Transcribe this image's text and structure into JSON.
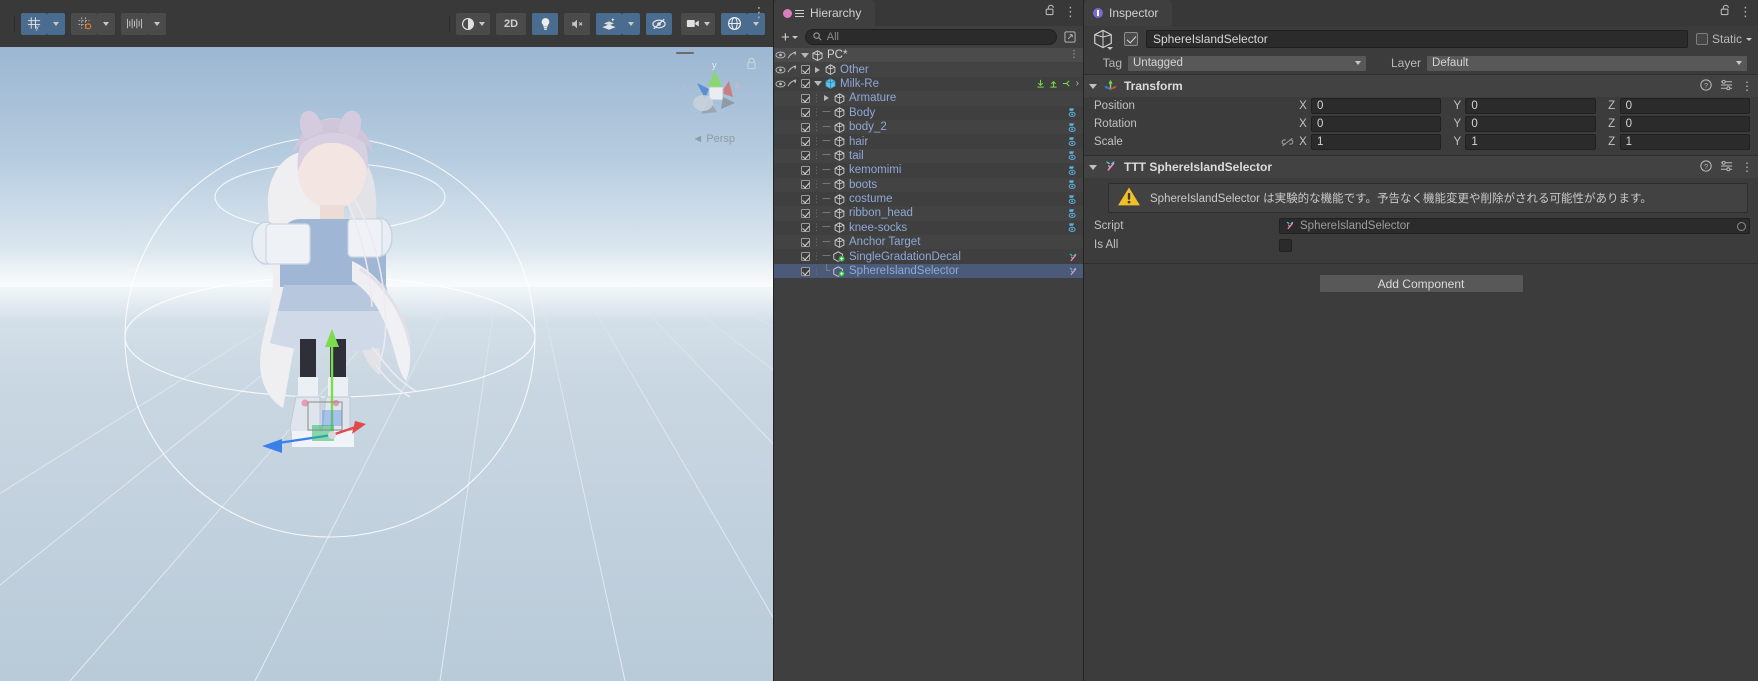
{
  "scene": {
    "toolbar": {
      "grid_visibility_icon": "grid-icon",
      "grid_visibility_dropdown": "chevron-down-icon",
      "grid_snapping_icon": "grid-snap-icon",
      "grid_snapping_dropdown": "chevron-down-icon",
      "snap_increment_icon": "snap-increment-icon",
      "snap_increment_dropdown": "chevron-down-icon",
      "draw_mode_icon": "shading-mode-icon",
      "draw_mode_dropdown": "chevron-down-icon",
      "twod_label": "2D",
      "lighting_icon": "lightbulb-icon",
      "audio_icon": "audio-mute-icon",
      "fx_icon": "effects-icon",
      "fx_dropdown": "chevron-down-icon",
      "hidden_objects_icon": "visibility-off-icon",
      "camera_icon": "scene-camera-icon",
      "camera_dropdown": "chevron-down-icon",
      "gizmos_icon": "gizmos-icon",
      "gizmos_dropdown": "chevron-down-icon",
      "overflow_menu_icon": "kebab-menu-icon"
    },
    "gizmo": {
      "axis_x": "x",
      "axis_y": "y",
      "axis_z": "z",
      "projection_label": "Persp",
      "lock_icon": "lock-icon"
    }
  },
  "hierarchy": {
    "tab_label": "Hierarchy",
    "tab_icon": "hierarchy-icon",
    "lock_icon": "lock-open-icon",
    "menu_icon": "kebab-menu-icon",
    "add_label": "+",
    "add_dropdown_icon": "chevron-down-icon",
    "search_icon": "search-icon",
    "search_placeholder": "All",
    "search_value": "",
    "sort_icon": "sort-icon",
    "scene_name": "PC*",
    "scene_icon": "unity-scene-icon",
    "scene_menu_icon": "kebab-menu-icon",
    "items": [
      {
        "name": "Other",
        "icon": "gameobject-icon",
        "depth": 0,
        "checked": true,
        "expand": "collapsed",
        "selected": false,
        "prefab": false,
        "branch": "",
        "visibility": false
      },
      {
        "name": "Milk-Re",
        "icon": "prefab-icon",
        "depth": 0,
        "checked": true,
        "expand": "expanded",
        "selected": false,
        "prefab": false,
        "branch": "",
        "visibility": false
      },
      {
        "name": "Armature",
        "icon": "gameobject-icon",
        "depth": 1,
        "checked": true,
        "expand": "collapsed",
        "selected": false,
        "prefab": false,
        "branch": "",
        "visibility": false
      },
      {
        "name": "Body",
        "icon": "gameobject-icon",
        "depth": 1,
        "checked": true,
        "expand": "none",
        "selected": false,
        "prefab": true,
        "branch": "tee",
        "visibility": true
      },
      {
        "name": "body_2",
        "icon": "gameobject-icon",
        "depth": 1,
        "checked": true,
        "expand": "none",
        "selected": false,
        "prefab": true,
        "branch": "tee",
        "visibility": true
      },
      {
        "name": "hair",
        "icon": "gameobject-icon",
        "depth": 1,
        "checked": true,
        "expand": "none",
        "selected": false,
        "prefab": true,
        "branch": "tee",
        "visibility": true
      },
      {
        "name": "tail",
        "icon": "gameobject-icon",
        "depth": 1,
        "checked": true,
        "expand": "none",
        "selected": false,
        "prefab": true,
        "branch": "tee",
        "visibility": true
      },
      {
        "name": "kemomimi",
        "icon": "gameobject-icon",
        "depth": 1,
        "checked": true,
        "expand": "none",
        "selected": false,
        "prefab": true,
        "branch": "tee",
        "visibility": true
      },
      {
        "name": "boots",
        "icon": "gameobject-icon",
        "depth": 1,
        "checked": true,
        "expand": "none",
        "selected": false,
        "prefab": true,
        "branch": "tee",
        "visibility": true
      },
      {
        "name": "costume",
        "icon": "gameobject-icon",
        "depth": 1,
        "checked": true,
        "expand": "none",
        "selected": false,
        "prefab": true,
        "branch": "tee",
        "visibility": true
      },
      {
        "name": "ribbon_head",
        "icon": "gameobject-icon",
        "depth": 1,
        "checked": true,
        "expand": "none",
        "selected": false,
        "prefab": true,
        "branch": "tee",
        "visibility": true
      },
      {
        "name": "knee-socks",
        "icon": "gameobject-icon",
        "depth": 1,
        "checked": true,
        "expand": "none",
        "selected": false,
        "prefab": true,
        "branch": "tee",
        "visibility": true
      },
      {
        "name": "Anchor Target",
        "icon": "gameobject-icon",
        "depth": 1,
        "checked": true,
        "expand": "none",
        "selected": false,
        "prefab": false,
        "branch": "tee",
        "visibility": false
      },
      {
        "name": "SingleGradationDecal",
        "icon": "script-gameobject-icon",
        "depth": 1,
        "checked": true,
        "expand": "none",
        "selected": false,
        "prefab": false,
        "branch": "tee",
        "visibility": true,
        "marker": "ttt"
      },
      {
        "name": "SphereIslandSelector",
        "icon": "script-gameobject-icon",
        "depth": 1,
        "checked": true,
        "expand": "none",
        "selected": true,
        "prefab": false,
        "branch": "end",
        "visibility": true,
        "marker": "ttt"
      }
    ]
  },
  "inspector": {
    "tab_label": "Inspector",
    "tab_icon": "inspector-icon",
    "lock_icon": "lock-open-icon",
    "menu_icon": "kebab-menu-icon",
    "object_icon": "gameobject-icon",
    "enabled": true,
    "object_name": "SphereIslandSelector",
    "static_label": "Static",
    "static_checked": false,
    "static_dropdown_icon": "chevron-down-icon",
    "tag_label": "Tag",
    "tag_value": "Untagged",
    "layer_label": "Layer",
    "layer_value": "Default",
    "components": [
      {
        "title": "Transform",
        "icon": "transform-icon",
        "help_icon": "help-icon",
        "preset_icon": "preset-icon",
        "menu_icon": "kebab-menu-icon",
        "rows": [
          {
            "label": "Position",
            "axes": [
              "X",
              "Y",
              "Z"
            ],
            "values": [
              "0",
              "0",
              "0"
            ],
            "link": false
          },
          {
            "label": "Rotation",
            "axes": [
              "X",
              "Y",
              "Z"
            ],
            "values": [
              "0",
              "0",
              "0"
            ],
            "link": false
          },
          {
            "label": "Scale",
            "axes": [
              "X",
              "Y",
              "Z"
            ],
            "values": [
              "1",
              "1",
              "1"
            ],
            "link": true,
            "link_icon": "constrain-proportions-off-icon"
          }
        ]
      },
      {
        "title": "TTT SphereIslandSelector",
        "icon": "ttt-script-icon",
        "help_icon": "help-icon",
        "preset_icon": "preset-icon",
        "menu_icon": "kebab-menu-icon",
        "helpbox": {
          "icon": "warning-icon",
          "text": "SphereIslandSelector は実験的な機能です。予告なく機能変更や削除がされる可能性があります。"
        },
        "fields": [
          {
            "label": "Script",
            "type": "object",
            "value": "SphereIslandSelector",
            "icon": "ttt-script-icon",
            "disabled": true
          },
          {
            "label": "Is All",
            "type": "bool",
            "value": false
          }
        ]
      }
    ],
    "add_component_label": "Add Component"
  }
}
